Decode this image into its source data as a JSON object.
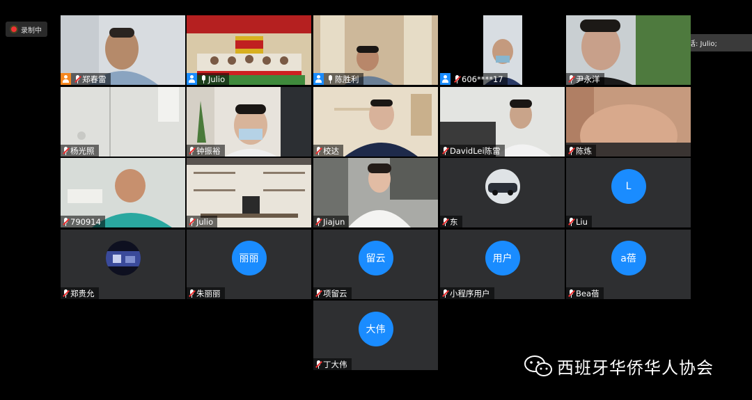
{
  "recording": {
    "label": "录制中"
  },
  "speaking": {
    "label": "正在讲话: Julio;"
  },
  "watermark": {
    "text": "西班牙华侨华人协会"
  },
  "tiles": [
    {
      "name": "郑春雷",
      "role": "host"
    },
    {
      "name": "Julio",
      "role": "cohost"
    },
    {
      "name": "陈胜利",
      "role": "cohost"
    },
    {
      "name": "606****17",
      "role": "cohost"
    },
    {
      "name": "尹永洋",
      "role": ""
    },
    {
      "name": "杨光照",
      "role": ""
    },
    {
      "name": "钟振裕",
      "role": ""
    },
    {
      "name": "校达",
      "role": ""
    },
    {
      "name": "DavidLei陈雷",
      "role": ""
    },
    {
      "name": "陈炼",
      "role": ""
    },
    {
      "name": "790914",
      "role": ""
    },
    {
      "name": "Julio",
      "role": ""
    },
    {
      "name": "Jiajun",
      "role": ""
    },
    {
      "name": "东",
      "role": ""
    },
    {
      "name": "Liu",
      "role": "",
      "avatar": "L"
    },
    {
      "name": "郑贵允",
      "role": ""
    },
    {
      "name": "朱丽丽",
      "role": "",
      "avatar": "丽丽"
    },
    {
      "name": "项留云",
      "role": "",
      "avatar": "留云"
    },
    {
      "name": "小程序用户",
      "role": "",
      "avatar": "用户"
    },
    {
      "name": "Bea蓓",
      "role": "",
      "avatar": "a蓓"
    },
    {
      "name": "丁大伟",
      "role": "",
      "avatar": "大伟"
    }
  ]
}
